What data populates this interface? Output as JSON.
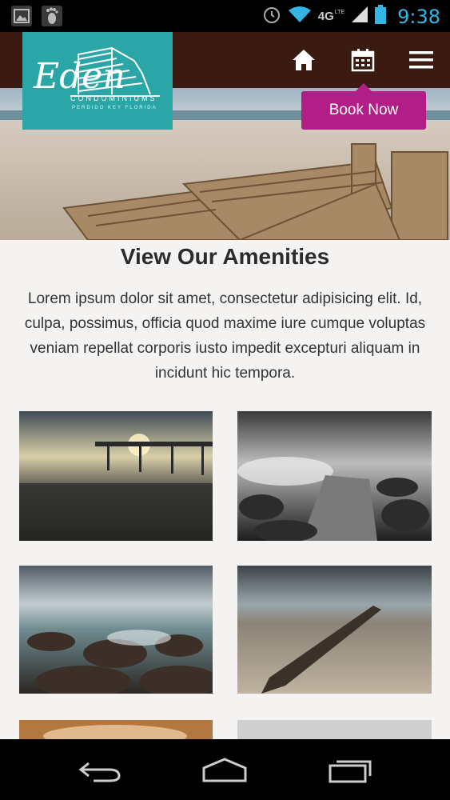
{
  "status_bar": {
    "time": "9:38",
    "network": "4G",
    "network_sub": "LTE",
    "left_icons": [
      "image-icon",
      "footprint-icon"
    ],
    "right_icons": [
      "alarm-icon",
      "wifi-icon",
      "signal-icon",
      "battery-icon"
    ]
  },
  "header": {
    "logo": {
      "script": "Eden",
      "name": "CONDOMINIUMS",
      "tagline": "PERDIDO KEY FLORIDA"
    },
    "nav": [
      "home-icon",
      "calendar-icon",
      "menu-icon"
    ],
    "book_button": "Book Now"
  },
  "main": {
    "title": "View Our Amenities",
    "intro": "Lorem ipsum dolor sit amet, consectetur adipisicing elit. Id, culpa, possimus, officia quod maxime iure cumque voluptas veniam repellat corporis iusto impedit excepturi aliquam in incidunt hic tempora."
  },
  "android_nav": [
    "back-icon",
    "home-icon",
    "recent-apps-icon"
  ],
  "colors": {
    "header": "#3b1a11",
    "logo_bg": "#2aa6a7",
    "book_button": "#b31e86",
    "status_accent": "#33b5e5"
  }
}
